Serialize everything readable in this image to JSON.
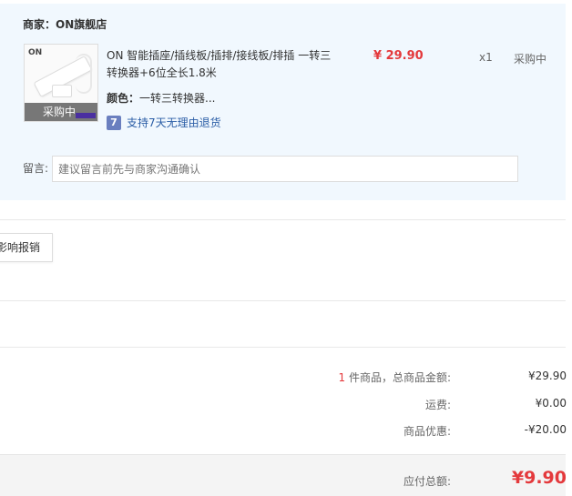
{
  "seller": {
    "label": "商家：ON旗舰店"
  },
  "item": {
    "thumb_brand": "ON",
    "thumb_tag": "采购中",
    "title": "ON 智能插座/插线板/插排/接线板/排插 一转三转换器+6位全长1.8米",
    "price": "¥ 29.90",
    "qty": "x1",
    "status": "采购中",
    "color_key": "颜色：",
    "color_value": "一转三转换器...",
    "return_badge": "7",
    "return_text": "支持7天无理由退货"
  },
  "message": {
    "label": "留言:",
    "placeholder": "建议留言前先与商家沟通确认"
  },
  "report_button": "影响报销",
  "summary": {
    "count": "1",
    "goods_label": "件商品，总商品金额:",
    "goods_value": "¥29.90",
    "shipping_label": "运费:",
    "shipping_value": "¥0.00",
    "discount_label": "商品优惠:",
    "discount_value": "-¥20.00",
    "total_label": "应付总额:",
    "total_value": "¥9.90"
  },
  "colors": {
    "accent": "#e4393c",
    "panel": "#f1f8fe",
    "link": "#2a5da6"
  }
}
